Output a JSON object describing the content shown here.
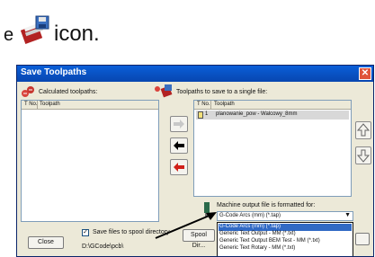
{
  "doc": {
    "icon": "toolpath-disk-icon",
    "text": "icon."
  },
  "dialog": {
    "title": "Save Toolpaths",
    "calc_label": "Calculated toolpaths:",
    "save_label": "Toolpaths to save to a single file:",
    "left_list": {
      "col1": "T No.",
      "col2": "Toolpath"
    },
    "right_list": {
      "col1": "T No.",
      "col2": "Toolpath",
      "rows": [
        {
          "num": "1",
          "name": "planowanie_pow - Walcowy_8mm"
        }
      ]
    },
    "format_label": "Machine output file is formatted for:",
    "format_selected": "G-Code Arcs (mm) (*.tap)",
    "format_options": [
      "G-Code Arcs (mm) (*.tap)",
      "Generic Text Output - MM (*.txt)",
      "Generic Text Output BEM Test - MM (*.txt)",
      "Generic Text Rotary - MM (*.txt)"
    ],
    "checkbox_label": "Save files to spool directory",
    "spool_path": "D:\\GCode\\pcb\\",
    "close_label": "Close",
    "spool_dir_label": "Spool Dir..."
  }
}
